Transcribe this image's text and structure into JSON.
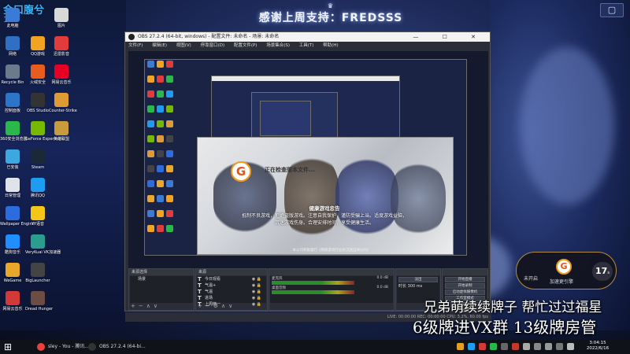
{
  "desktop": {
    "corner_text": "金口腹兮",
    "corner_subtext": "1",
    "banner_crest": "♛",
    "banner_text": "感谢上周支持：FREDSSS",
    "topright_icon": "▢",
    "icons_left": [
      {
        "label": "此电脑",
        "color": "#3a7bd5"
      },
      {
        "label": "网络",
        "color": "#2f6fc4"
      },
      {
        "label": "Recycle Bin",
        "color": "#6b7b8c"
      },
      {
        "label": "控制面板",
        "color": "#2c75c9"
      },
      {
        "label": "360安全浏览器",
        "color": "#2bb84a"
      },
      {
        "label": "已安装",
        "color": "#3da8e0"
      },
      {
        "label": "日常管理",
        "color": "#e0e4ea"
      },
      {
        "label": "Wallpaper Engine",
        "color": "#2d6cdf"
      },
      {
        "label": "酷狗音乐",
        "color": "#1f8fff"
      },
      {
        "label": "WeGame",
        "color": "#e9a72b"
      },
      {
        "label": "网易云音乐",
        "color": "#d23a3a"
      }
    ],
    "icons_col2": [
      {
        "label": "QQ游戏",
        "color": "#f2a322"
      },
      {
        "label": "火绒安全",
        "color": "#e85c1e"
      },
      {
        "label": "OBS Studio",
        "color": "#333333"
      },
      {
        "label": "GeForce Experience",
        "color": "#76b900"
      },
      {
        "label": "Steam",
        "color": "#1b2838"
      },
      {
        "label": "腾讯QQ",
        "color": "#1e9cf0"
      },
      {
        "label": "YY语音",
        "color": "#f5c518"
      },
      {
        "label": "VeryKuai VK加速器",
        "color": "#2a9d8f"
      },
      {
        "label": "BigLauncher",
        "color": "#444444"
      },
      {
        "label": "Dread Hunger",
        "color": "#6d4c41"
      }
    ],
    "icons_col3": [
      {
        "label": "图片",
        "color": "#d9d9d9"
      },
      {
        "label": "迅雷影音",
        "color": "#e23b3b"
      },
      {
        "label": "网易云音乐",
        "color": "#e60026"
      },
      {
        "label": "Counter-Strike",
        "color": "#de9b35"
      },
      {
        "label": "英雄联盟",
        "color": "#c89b3c"
      }
    ]
  },
  "obs": {
    "title": "OBS 27.2.4 (64-bit, windows) - 配置文件: 未命名 - 场景: 未命名",
    "window_buttons": "— ☐ ✕",
    "menu": [
      "文件(F)",
      "编辑(E)",
      "视图(V)",
      "停靠窗口(D)",
      "配置文件(P)",
      "场景集合(S)",
      "工具(T)",
      "帮助(H)"
    ],
    "docks": {
      "scenes_title": "来源选择",
      "scene_col": "场景",
      "sources_col": "来源",
      "sources": [
        "今日观看",
        "气温+",
        "气温",
        "进场",
        "上周榜一"
      ],
      "mixer": [
        {
          "label": "麦克风",
          "value": "0.0 dB"
        },
        {
          "label": "桌面音频",
          "value": "0.0 dB"
        }
      ],
      "transition": {
        "type": "淡出",
        "duration_label": "时长",
        "duration": "300 ms"
      },
      "controls": [
        "开始直播",
        "开始录制",
        "启动虚拟摄像机",
        "工作室模式",
        "设置",
        "退出"
      ]
    },
    "statusbar": "LIVE: 00:00:00   REC: 00:00:00   CPU: 3.2%, 60.00 fps"
  },
  "splash": {
    "logo": "G",
    "status": "正在检查版本文件...",
    "notice_title": "健康游戏忠告",
    "notice_body": "抵制不良游戏，拒绝盗版游戏。注意自我保护，谨防受骗上当。适度游戏益脑，沉迷游戏伤身。合理安排时间，享受健康生活。",
    "footer": "本公司积极履行《网络游戏行业防沉迷自律公约》"
  },
  "speed_widget": {
    "logo": "G",
    "time_label": "未开启",
    "name": "加速更引擎",
    "count": "17",
    "count_suffix": "s"
  },
  "captions": {
    "line1": "兄弟萌续续牌子 帮忙过过福星",
    "line2": "6级牌进VX群 13级牌房管"
  },
  "taskbar": {
    "start": "⊞",
    "items": [
      {
        "label": "sley - You - 腾讯...",
        "color": "#e9413c"
      },
      {
        "label": "OBS 27.2.4 (64-bi...",
        "color": "#333333"
      }
    ],
    "clock_time": "3:04:15",
    "clock_date": "2022/6/16"
  }
}
